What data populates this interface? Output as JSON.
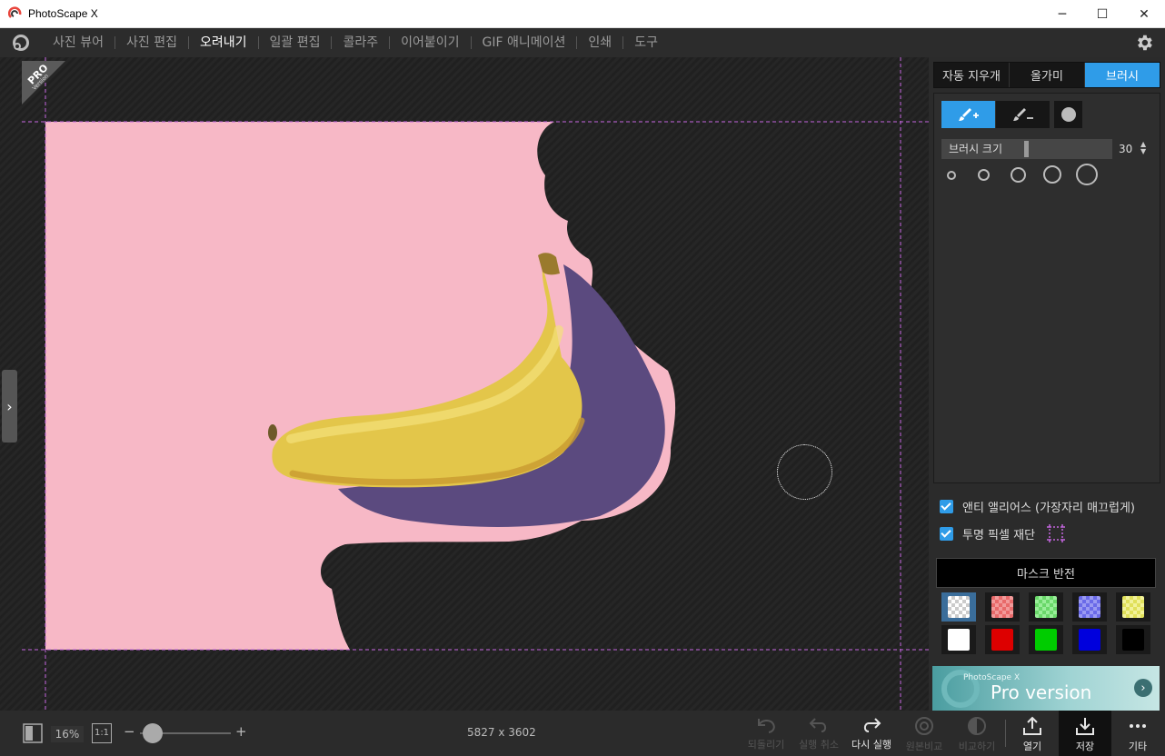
{
  "window": {
    "title": "PhotoScape X",
    "controls": [
      "─",
      "☐",
      "✕"
    ]
  },
  "menu": {
    "items": [
      {
        "label": "사진 뷰어",
        "active": false
      },
      {
        "label": "사진 편집",
        "active": false
      },
      {
        "label": "오려내기",
        "active": true
      },
      {
        "label": "일괄 편집",
        "active": false
      },
      {
        "label": "콜라주",
        "active": false
      },
      {
        "label": "이어붙이기",
        "active": false
      },
      {
        "label": "GIF 애니메이션",
        "active": false
      },
      {
        "label": "인쇄",
        "active": false
      },
      {
        "label": "도구",
        "active": false
      }
    ]
  },
  "canvas": {
    "pro_badge_top": "PRO",
    "pro_badge_bottom": "Version",
    "colors": {
      "background_pink": "#f7b8c6",
      "masked_dark": "#232323",
      "guide": "#c566e0"
    }
  },
  "panel": {
    "tabs": [
      {
        "label": "자동 지우개",
        "active": false
      },
      {
        "label": "올가미",
        "active": false
      },
      {
        "label": "브러시",
        "active": true
      }
    ],
    "tools": [
      {
        "icon": "brush-add-icon",
        "active": true
      },
      {
        "icon": "brush-erase-icon",
        "active": false
      },
      {
        "icon": "circle-brush-icon",
        "active": false
      }
    ],
    "brush_size_label": "브러시 크기",
    "brush_size_value": "30",
    "brush_size_fraction": 0.3,
    "anti_alias_label": "앤티 앨리어스 (가장자리 매끄럽게)",
    "crop_transparent_label": "투명 픽셀 재단",
    "mask_invert_label": "마스크 반전",
    "swatches_row1": [
      "checker-white",
      "checker-red",
      "checker-green",
      "checker-blue",
      "checker-yellow"
    ],
    "swatches_row2": [
      "#ffffff",
      "#dd0000",
      "#00cc00",
      "#0000dd",
      "#000000"
    ],
    "promo_small": "PhotoScape X",
    "promo_big": "Pro version"
  },
  "bottom": {
    "zoom": "16%",
    "ratio_label": "1:1",
    "zoom_minus": "−",
    "zoom_plus": "+",
    "image_size": "5827 x 3602",
    "buttons": [
      {
        "label": "되돌리기",
        "icon": "revert-icon",
        "enabled": false
      },
      {
        "label": "실행 취소",
        "icon": "undo-icon",
        "enabled": false
      },
      {
        "label": "다시 실행",
        "icon": "redo-icon",
        "enabled": true
      },
      {
        "label": "원본비교",
        "icon": "compare-original-icon",
        "enabled": false
      },
      {
        "label": "비교하기",
        "icon": "compare-icon",
        "enabled": false
      },
      {
        "label": "열기",
        "icon": "open-icon",
        "enabled": true
      },
      {
        "label": "저장",
        "icon": "save-icon",
        "enabled": true
      },
      {
        "label": "기타",
        "icon": "more-icon",
        "enabled": true
      }
    ]
  }
}
